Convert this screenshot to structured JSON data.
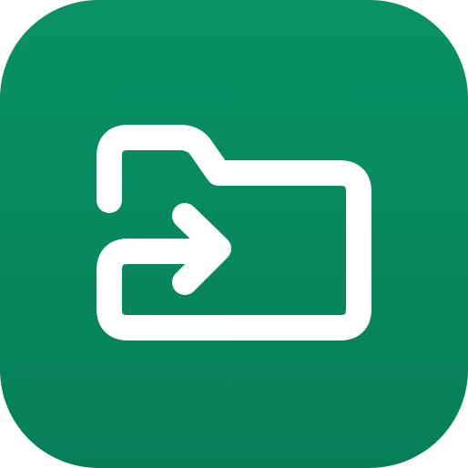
{
  "app_icon": {
    "icon": "folder-move-icon",
    "colors": {
      "background_top": "#089266",
      "background_bottom": "#067F59",
      "glyph": "#FFFFFF"
    }
  }
}
